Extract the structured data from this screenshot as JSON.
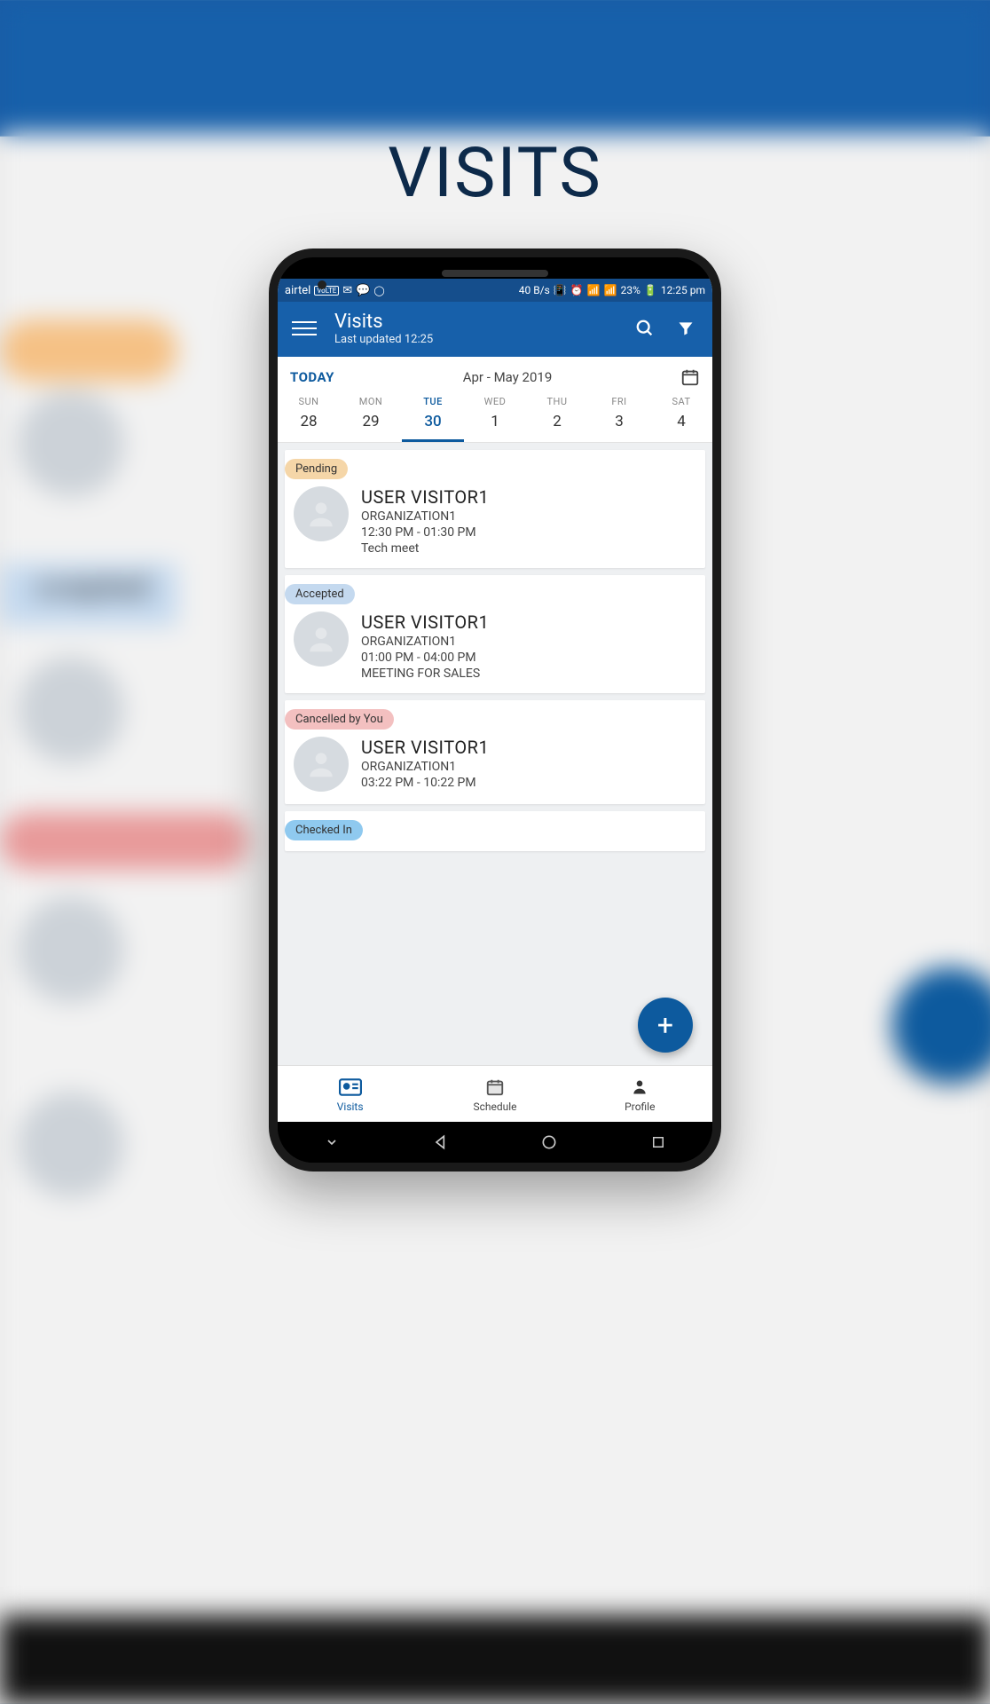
{
  "pageTitle": "VISITS",
  "statusBar": {
    "carrier": "airtel",
    "volte": "VoLTE",
    "dataRate": "40 B/s",
    "battery": "23%",
    "time": "12:25 pm"
  },
  "header": {
    "title": "Visits",
    "subtitle": "Last updated 12:25"
  },
  "calendar": {
    "todayLabel": "TODAY",
    "monthRange": "Apr - May 2019",
    "days": [
      {
        "abbr": "SUN",
        "num": "28",
        "selected": false
      },
      {
        "abbr": "MON",
        "num": "29",
        "selected": false
      },
      {
        "abbr": "TUE",
        "num": "30",
        "selected": true
      },
      {
        "abbr": "WED",
        "num": "1",
        "selected": false
      },
      {
        "abbr": "THU",
        "num": "2",
        "selected": false
      },
      {
        "abbr": "FRI",
        "num": "3",
        "selected": false
      },
      {
        "abbr": "SAT",
        "num": "4",
        "selected": false
      }
    ]
  },
  "visits": [
    {
      "status": "Pending",
      "statusClass": "pending",
      "name": "USER VISITOR1",
      "org": "ORGANIZATION1",
      "time": "12:30 PM - 01:30 PM",
      "purpose": "Tech meet"
    },
    {
      "status": "Accepted",
      "statusClass": "accepted",
      "name": "USER VISITOR1",
      "org": "ORGANIZATION1",
      "time": "01:00 PM - 04:00 PM",
      "purpose": "MEETING FOR SALES"
    },
    {
      "status": "Cancelled by You",
      "statusClass": "cancelled",
      "name": "USER VISITOR1",
      "org": "ORGANIZATION1",
      "time": "03:22 PM - 10:22 PM",
      "purpose": ""
    },
    {
      "status": "Checked In",
      "statusClass": "checkedin",
      "name": "",
      "org": "",
      "time": "",
      "purpose": ""
    }
  ],
  "tabs": [
    {
      "label": "Visits",
      "active": true,
      "icon": "id-card"
    },
    {
      "label": "Schedule",
      "active": false,
      "icon": "calendar"
    },
    {
      "label": "Profile",
      "active": false,
      "icon": "person"
    }
  ],
  "backgroundLabel": "ccepted"
}
